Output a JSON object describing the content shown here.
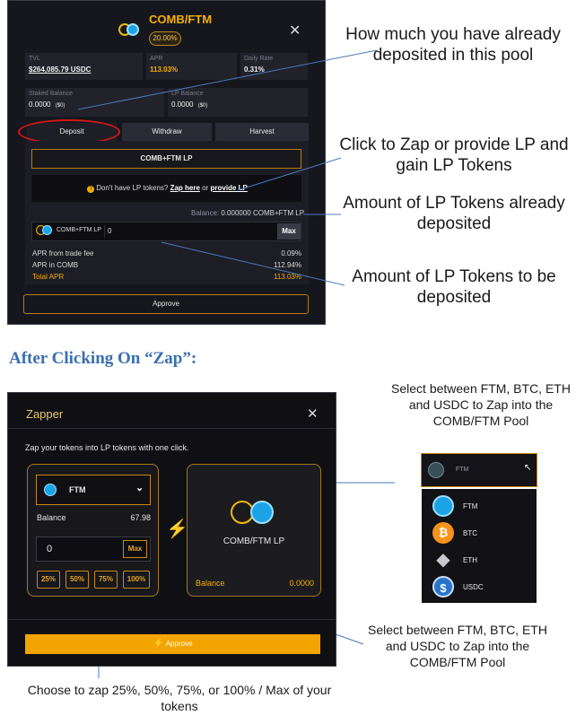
{
  "top_modal": {
    "title": "COMB/FTM",
    "badge": "20.00%",
    "close": "✕",
    "tvl_label": "TVL",
    "tvl_value": "$264,085.79 USDC",
    "apr_label": "APR",
    "apr_value": "113.03%",
    "daily_label": "Daily Rate",
    "daily_value": "0.31%",
    "staked_label": "Staked Balance",
    "staked_value": "0.0000",
    "staked_unit": "($0)",
    "lp_label": "LP Balance",
    "lp_value": "0.0000",
    "lp_unit": "($0)",
    "tabs": [
      "Deposit",
      "Withdraw",
      "Harvest"
    ],
    "pair_button": "COMB+FTM LP",
    "no_lp_text": "Don't have LP tokens?",
    "zap_here": "Zap here",
    "or": "or",
    "provide_lp": "provide LP",
    "balance_label": "Balance:",
    "balance_value": "0.000000 COMB+FTM LP",
    "input_token": "COMB+FTM LP",
    "input_value": "0",
    "max": "Max",
    "rows": [
      {
        "label": "APR from trade fee",
        "value": "0.09%"
      },
      {
        "label": "APR in COMB",
        "value": "112.94%"
      },
      {
        "label": "Total APR",
        "value": "113.03%"
      }
    ],
    "approve": "Approve"
  },
  "annotations": {
    "deposited": "How much you have already deposited in this pool",
    "zap": "Click to Zap or provide LP and gain LP Tokens",
    "lp_already": "Amount of LP Tokens already deposited",
    "lp_tobe": "Amount of LP Tokens to be deposited",
    "heading": "After Clicking On “Zap”:",
    "select_top": "Select between FTM, BTC, ETH and USDC to Zap into the COMB/FTM Pool",
    "select_bottom": "Select between FTM, BTC, ETH and USDC to Zap into the COMB/FTM Pool",
    "choose": "Choose to zap 25%, 50%, 75%, or 100% / Max  of your tokens"
  },
  "zapper": {
    "title": "Zapper",
    "close": "✕",
    "subtitle": "Zap your tokens into LP tokens with one click.",
    "token": "FTM",
    "balance_label": "Balance",
    "balance_value": "67.98",
    "amount": "0",
    "max": "Max",
    "percents": [
      "25%",
      "50%",
      "75%",
      "100%"
    ],
    "target": "COMB/FTM LP",
    "target_balance_label": "Balance",
    "target_balance_value": "0.0000",
    "approve": "Approve"
  },
  "selector": {
    "selected": "FTM",
    "options": [
      "FTM",
      "BTC",
      "ETH",
      "USDC"
    ]
  }
}
